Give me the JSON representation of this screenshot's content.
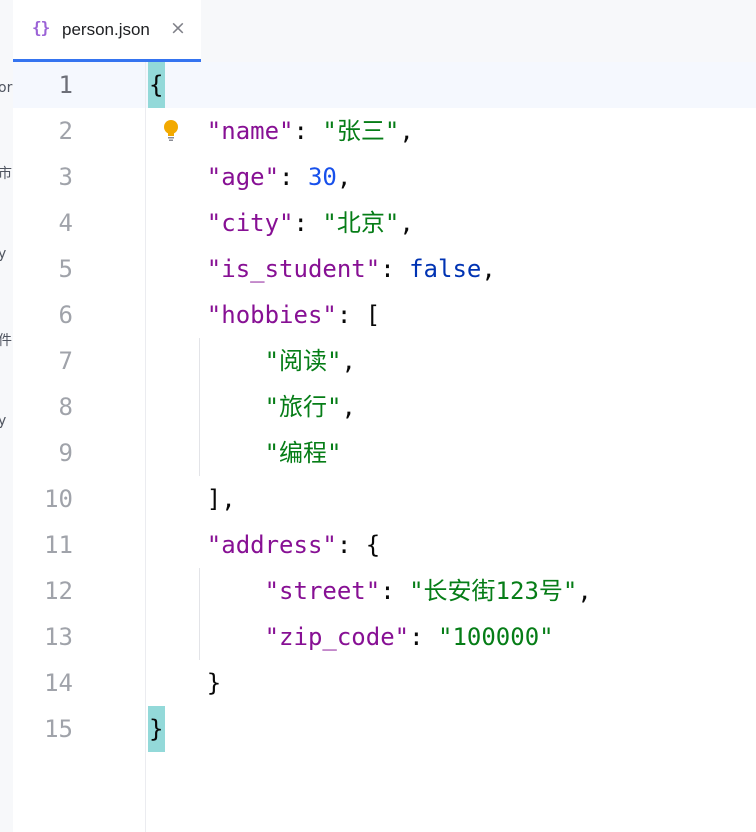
{
  "tab": {
    "icon": "{}",
    "label": "person.json",
    "close": "×"
  },
  "left_strip": [
    "or",
    "市",
    "y",
    "件",
    "y"
  ],
  "icons": {
    "file_type": "json-braces-icon",
    "intention": "lightbulb-icon",
    "close": "close-icon"
  },
  "colors": {
    "accent": "#3574f0",
    "key": "#871094",
    "string": "#067d17",
    "number": "#1750eb",
    "boolean": "#0033b3",
    "bulb": "#f2a900",
    "brace_match": "#93d9d9"
  },
  "editor": {
    "current_line": 1,
    "lines": [
      {
        "num": "1",
        "tokens": [
          {
            "t": "p",
            "v": "{"
          }
        ]
      },
      {
        "num": "2",
        "tokens": [
          {
            "t": "p",
            "v": "    "
          },
          {
            "t": "k",
            "v": "\"name\""
          },
          {
            "t": "p",
            "v": ": "
          },
          {
            "t": "s",
            "v": "\"张三\""
          },
          {
            "t": "p",
            "v": ","
          }
        ]
      },
      {
        "num": "3",
        "tokens": [
          {
            "t": "p",
            "v": "    "
          },
          {
            "t": "k",
            "v": "\"age\""
          },
          {
            "t": "p",
            "v": ": "
          },
          {
            "t": "n",
            "v": "30"
          },
          {
            "t": "p",
            "v": ","
          }
        ]
      },
      {
        "num": "4",
        "tokens": [
          {
            "t": "p",
            "v": "    "
          },
          {
            "t": "k",
            "v": "\"city\""
          },
          {
            "t": "p",
            "v": ": "
          },
          {
            "t": "s",
            "v": "\"北京\""
          },
          {
            "t": "p",
            "v": ","
          }
        ]
      },
      {
        "num": "5",
        "tokens": [
          {
            "t": "p",
            "v": "    "
          },
          {
            "t": "k",
            "v": "\"is_student\""
          },
          {
            "t": "p",
            "v": ": "
          },
          {
            "t": "b",
            "v": "false"
          },
          {
            "t": "p",
            "v": ","
          }
        ]
      },
      {
        "num": "6",
        "tokens": [
          {
            "t": "p",
            "v": "    "
          },
          {
            "t": "k",
            "v": "\"hobbies\""
          },
          {
            "t": "p",
            "v": ": ["
          }
        ]
      },
      {
        "num": "7",
        "tokens": [
          {
            "t": "p",
            "v": "        "
          },
          {
            "t": "s",
            "v": "\"阅读\""
          },
          {
            "t": "p",
            "v": ","
          }
        ]
      },
      {
        "num": "8",
        "tokens": [
          {
            "t": "p",
            "v": "        "
          },
          {
            "t": "s",
            "v": "\"旅行\""
          },
          {
            "t": "p",
            "v": ","
          }
        ]
      },
      {
        "num": "9",
        "tokens": [
          {
            "t": "p",
            "v": "        "
          },
          {
            "t": "s",
            "v": "\"编程\""
          }
        ]
      },
      {
        "num": "10",
        "tokens": [
          {
            "t": "p",
            "v": "    ],"
          }
        ]
      },
      {
        "num": "11",
        "tokens": [
          {
            "t": "p",
            "v": "    "
          },
          {
            "t": "k",
            "v": "\"address\""
          },
          {
            "t": "p",
            "v": ": {"
          }
        ]
      },
      {
        "num": "12",
        "tokens": [
          {
            "t": "p",
            "v": "        "
          },
          {
            "t": "k",
            "v": "\"street\""
          },
          {
            "t": "p",
            "v": ": "
          },
          {
            "t": "s",
            "v": "\"长安街123号\""
          },
          {
            "t": "p",
            "v": ","
          }
        ]
      },
      {
        "num": "13",
        "tokens": [
          {
            "t": "p",
            "v": "        "
          },
          {
            "t": "k",
            "v": "\"zip_code\""
          },
          {
            "t": "p",
            "v": ": "
          },
          {
            "t": "s",
            "v": "\"100000\""
          }
        ]
      },
      {
        "num": "14",
        "tokens": [
          {
            "t": "p",
            "v": "    }"
          }
        ]
      },
      {
        "num": "15",
        "tokens": [
          {
            "t": "p",
            "v": "}"
          }
        ]
      }
    ]
  }
}
